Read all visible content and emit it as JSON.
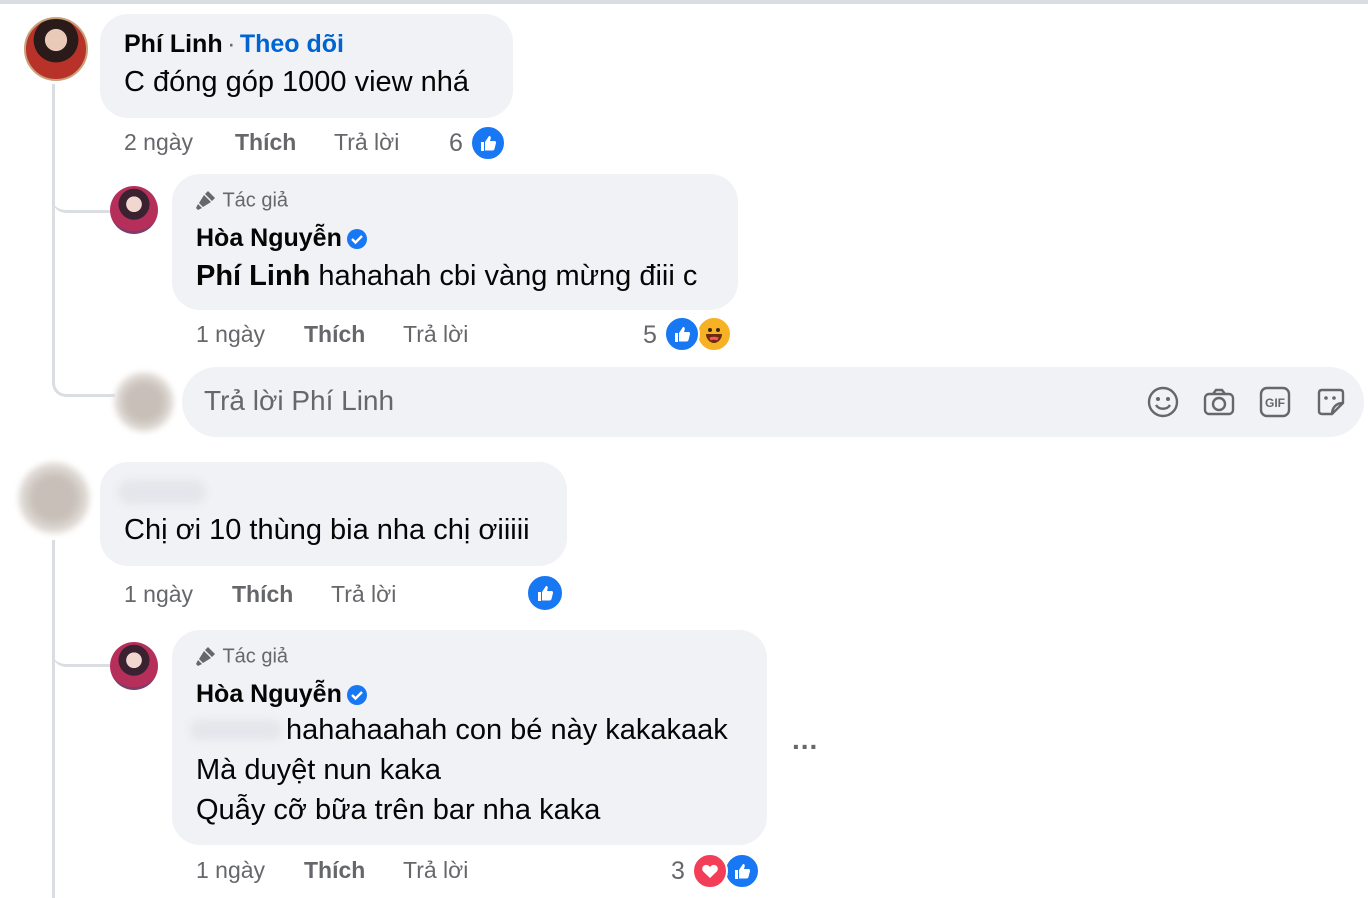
{
  "comment1": {
    "author": "Phí Linh",
    "separator": "·",
    "follow_label": "Theo dõi",
    "text": "C đóng góp 1000 view nhá",
    "time": "2 ngày",
    "like_label": "Thích",
    "reply_label": "Trả lời",
    "reaction_count": "6"
  },
  "reply1": {
    "author_tag": "Tác giả",
    "author": "Hòa Nguyễn",
    "mention": "Phí Linh",
    "text": " hahahah cbi vàng mừng điii c",
    "time": "1 ngày",
    "like_label": "Thích",
    "reply_label": "Trả lời",
    "reaction_count": "5"
  },
  "reply_box": {
    "placeholder": "Trả lời Phí Linh",
    "tools": [
      "smile-icon",
      "camera-icon",
      "gif-icon",
      "sticker-icon"
    ]
  },
  "comment2": {
    "text": "Chị ơi 10 thùng bia nha chị ơiiiii",
    "time": "1 ngày",
    "like_label": "Thích",
    "reply_label": "Trả lời"
  },
  "reply2": {
    "author_tag": "Tác giả",
    "author": "Hòa Nguyễn",
    "line1": "hahahaahah con bé này kakakaak",
    "line2": "Mà duyệt nun kaka",
    "line3": "Quẫy cỡ bữa trên bar nha kaka",
    "more": "...",
    "time": "1 ngày",
    "like_label": "Thích",
    "reply_label": "Trả lời",
    "reaction_count": "3"
  },
  "colors": {
    "accent": "#0064d1",
    "like": "#1877f2",
    "love": "#f33e58",
    "haha": "#f7b125",
    "bubble": "#f0f2f5",
    "meta": "#65676b"
  }
}
